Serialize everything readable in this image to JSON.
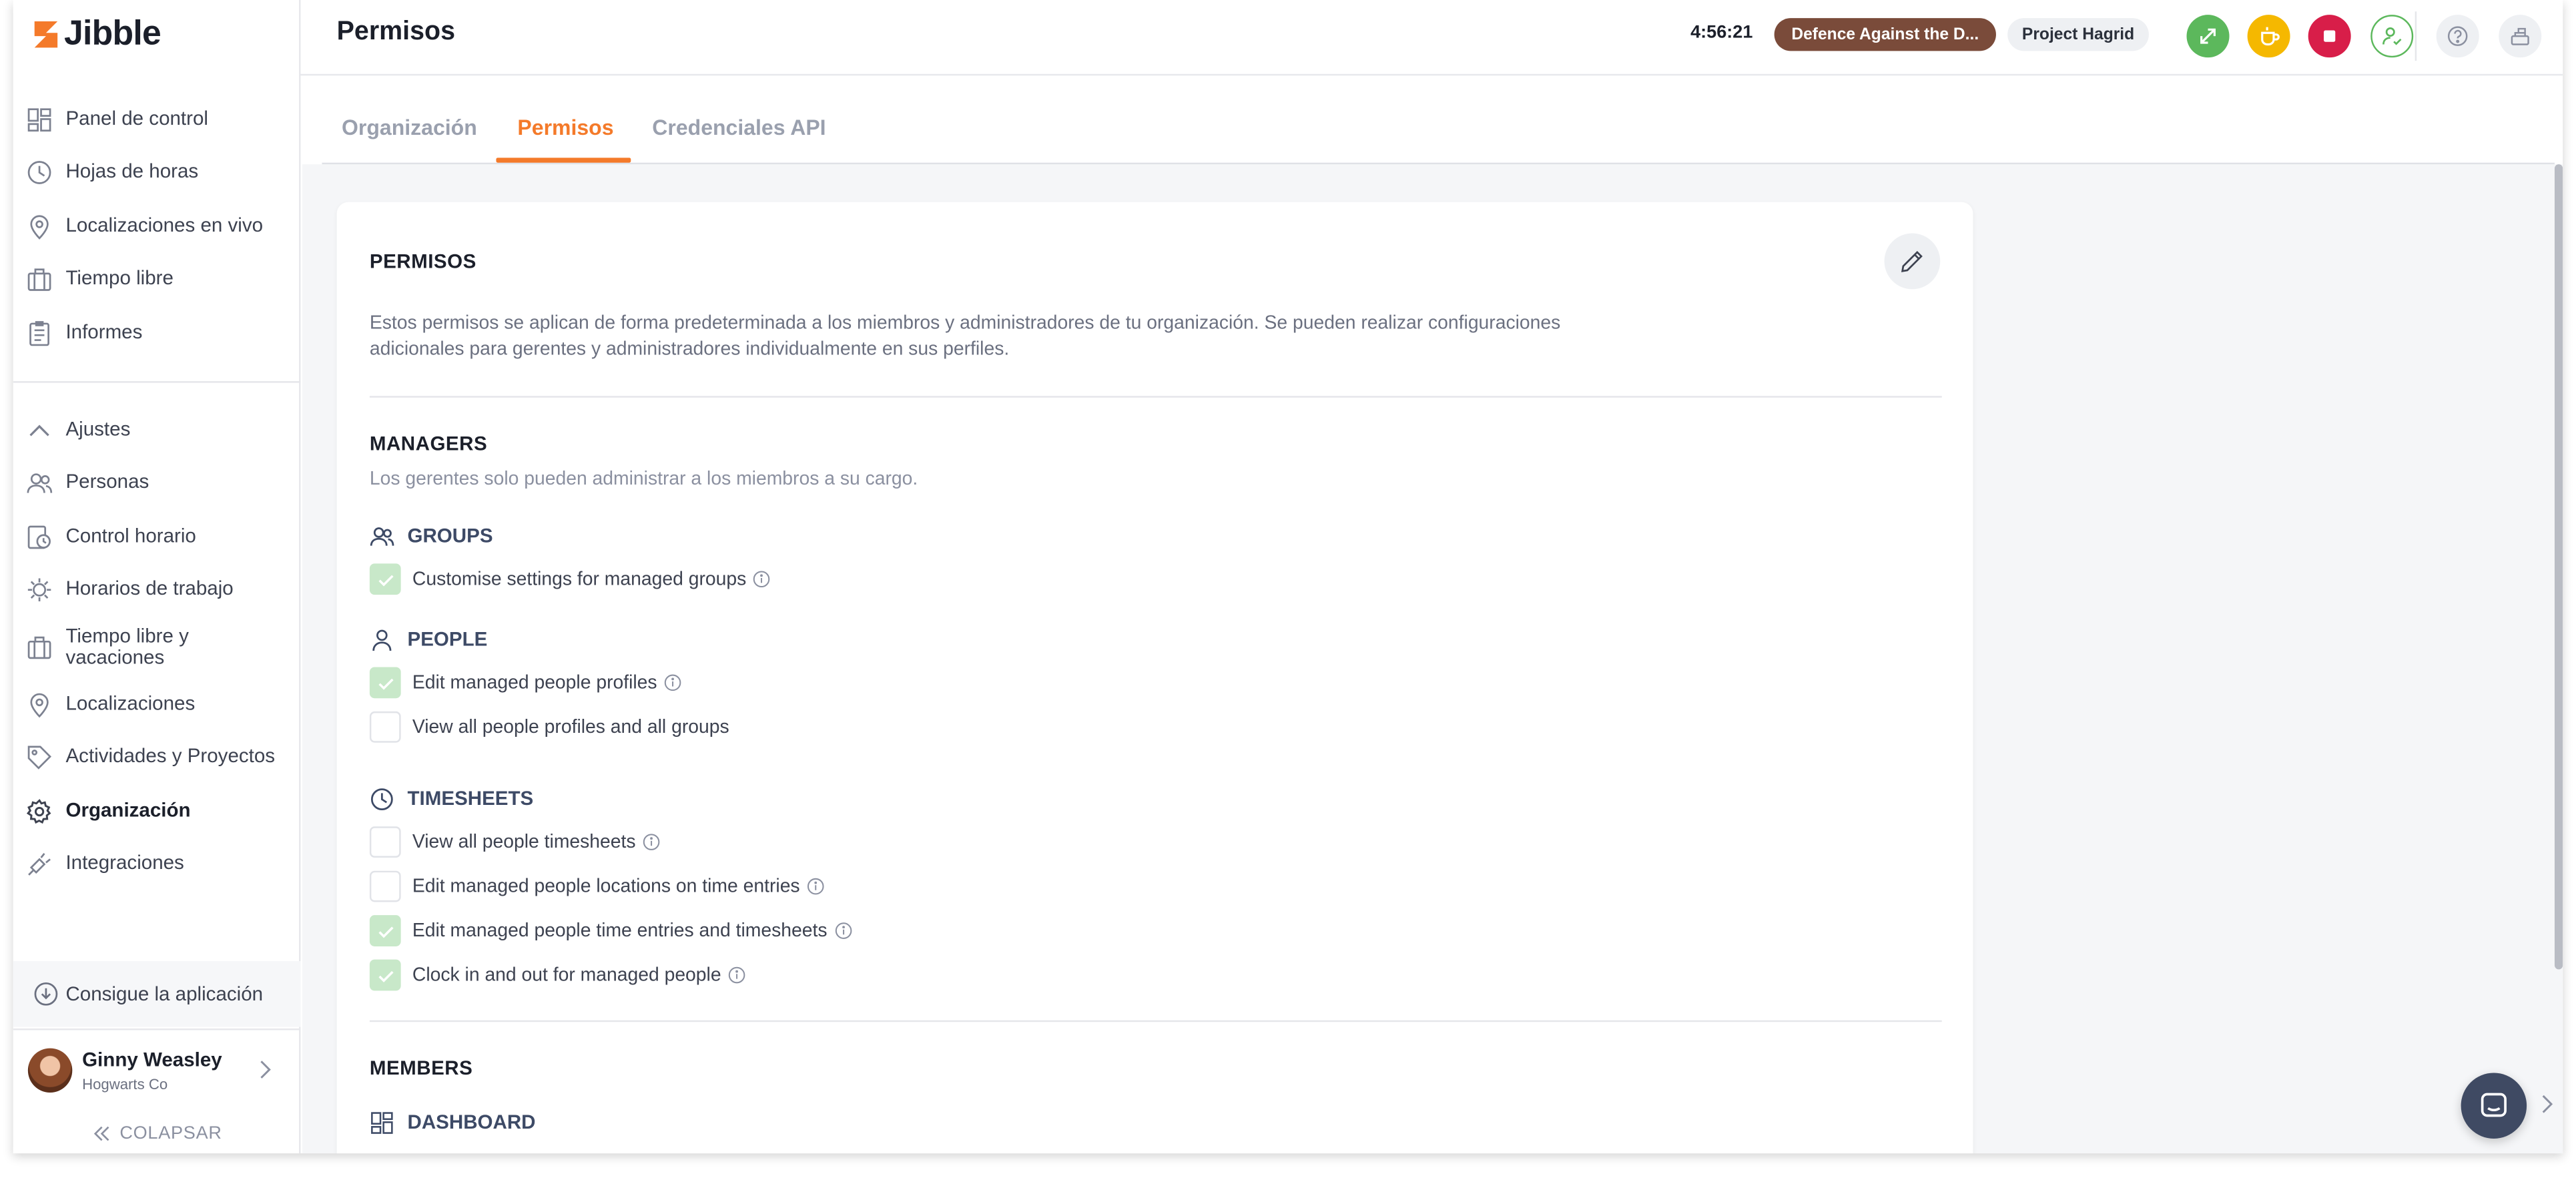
{
  "brand": {
    "name": "Jibble",
    "accent": "#f47a2a"
  },
  "sidebar": {
    "items": [
      {
        "label": "Panel de control",
        "icon": "dashboard-icon"
      },
      {
        "label": "Hojas de horas",
        "icon": "clock-icon"
      },
      {
        "label": "Localizaciones en vivo",
        "icon": "location-pin-icon"
      },
      {
        "label": "Tiempo libre",
        "icon": "suitcase-icon"
      },
      {
        "label": "Informes",
        "icon": "report-icon"
      }
    ],
    "settings_items": [
      {
        "label": "Ajustes",
        "icon": "chevron-up-icon"
      },
      {
        "label": "Personas",
        "icon": "people-icon"
      },
      {
        "label": "Control horario",
        "icon": "time-tracking-icon"
      },
      {
        "label": "Horarios de trabajo",
        "icon": "schedule-icon"
      },
      {
        "label": "Tiempo libre y vacaciones",
        "icon": "suitcase-icon"
      },
      {
        "label": "Localizaciones",
        "icon": "location-pin-icon"
      },
      {
        "label": "Actividades y Proyectos",
        "icon": "tag-icon"
      },
      {
        "label": "Organización",
        "icon": "gear-icon",
        "active": true
      },
      {
        "label": "Integraciones",
        "icon": "plug-icon"
      }
    ],
    "get_app": "Consigue la aplicación",
    "user": {
      "name": "Ginny Weasley",
      "org": "Hogwarts Co"
    },
    "collapse": "COLAPSAR"
  },
  "header": {
    "title": "Permisos",
    "timer": "4:56:21",
    "activity": "Defence Against the D...",
    "project": "Project Hagrid",
    "activity_color": "#7a4b3a"
  },
  "tabs": [
    {
      "label": "Organización",
      "active": false
    },
    {
      "label": "Permisos",
      "active": true
    },
    {
      "label": "Credenciales API",
      "active": false
    }
  ],
  "permissions": {
    "title": "PERMISOS",
    "description": "Estos permisos se aplican de forma predeterminada a los miembros y administradores de tu organización. Se pueden realizar configuraciones adicionales para gerentes y administradores individualmente en sus perfiles.",
    "managers": {
      "title": "MANAGERS",
      "description": "Los gerentes solo pueden administrar a los miembros a su cargo.",
      "groups": [
        {
          "title": "GROUPS",
          "items": [
            {
              "label": "Customise settings for managed groups",
              "checked": true,
              "info": true
            }
          ]
        },
        {
          "title": "PEOPLE",
          "items": [
            {
              "label": "Edit managed people profiles",
              "checked": true,
              "info": true
            },
            {
              "label": "View all people profiles and all groups",
              "checked": false,
              "info": false
            }
          ]
        },
        {
          "title": "TIMESHEETS",
          "items": [
            {
              "label": "View all people timesheets",
              "checked": false,
              "info": true
            },
            {
              "label": "Edit managed people locations on time entries",
              "checked": false,
              "info": true
            },
            {
              "label": "Edit managed people time entries and timesheets",
              "checked": true,
              "info": true
            },
            {
              "label": "Clock in and out for managed people",
              "checked": true,
              "info": true
            }
          ]
        }
      ]
    },
    "members": {
      "title": "MEMBERS",
      "groups": [
        {
          "title": "DASHBOARD"
        }
      ]
    }
  }
}
